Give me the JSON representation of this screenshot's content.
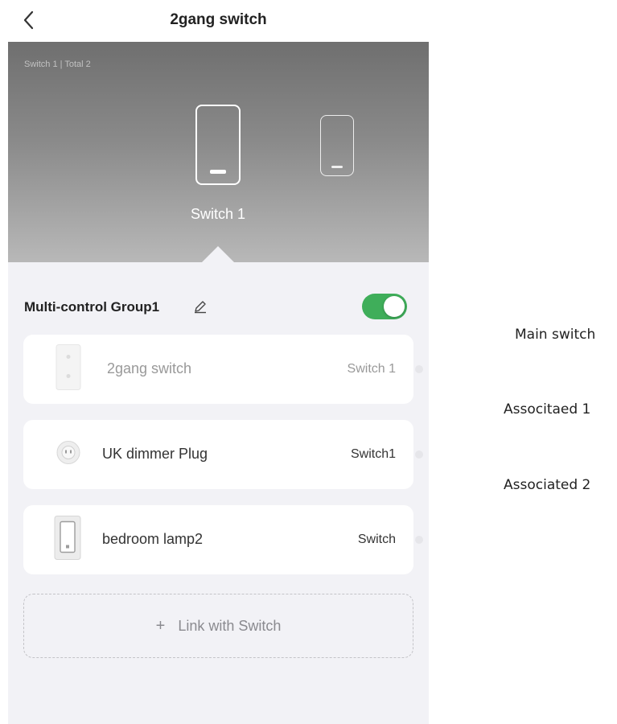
{
  "header": {
    "title": "2gang switch",
    "back_icon": "chevron-left-icon"
  },
  "hero": {
    "count_text": "Switch 1 | Total 2",
    "selected_label": "Switch 1",
    "switches": [
      "switch-1",
      "switch-2"
    ]
  },
  "group": {
    "title": "Multi-control Group1",
    "edit_icon": "pencil-icon",
    "enabled": true
  },
  "devices": [
    {
      "name": "2gang switch",
      "channel": "Switch 1",
      "icon": "wall-switch-2gang-icon",
      "role": "main"
    },
    {
      "name": "UK dimmer Plug",
      "channel": "Switch1",
      "icon": "smart-plug-icon",
      "role": "associated"
    },
    {
      "name": "bedroom lamp2",
      "channel": "Switch",
      "icon": "wall-switch-icon",
      "role": "associated"
    }
  ],
  "link_button": {
    "plus": "+",
    "label": "Link with Switch"
  },
  "annotations": [
    "Main switch",
    "Associtaed 1",
    "Associated 2"
  ],
  "colors": {
    "toggle_on": "#3fae5a",
    "hero_top": "#6f6f6f",
    "hero_bottom": "#b8b8b8",
    "background": "#f2f2f6"
  }
}
